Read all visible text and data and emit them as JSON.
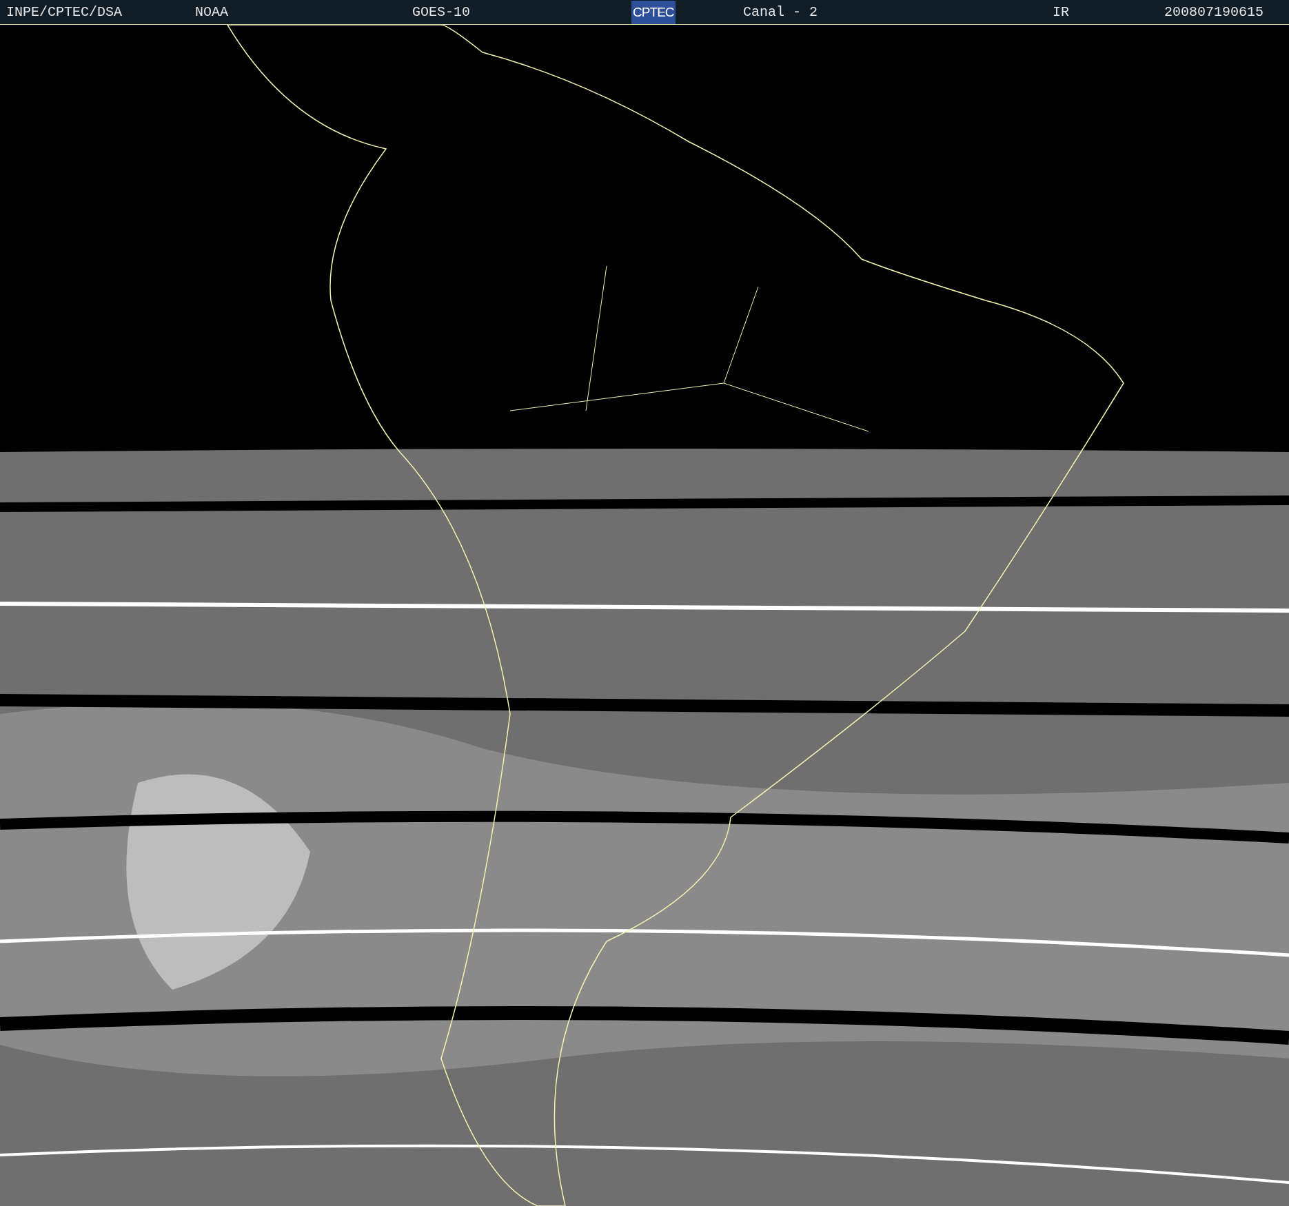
{
  "header": {
    "source": "INPE/CPTEC/DSA",
    "agency": "NOAA",
    "satellite": "GOES-10",
    "logo": "CPTEC",
    "channel": "Canal - 2",
    "band": "IR",
    "timestamp": "200807190615"
  }
}
